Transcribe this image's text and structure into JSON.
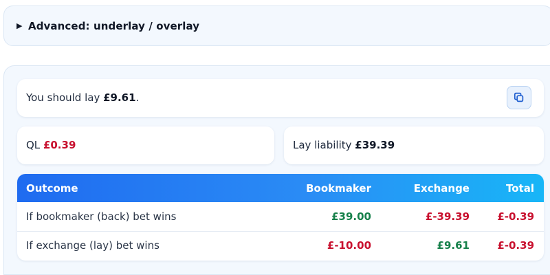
{
  "advanced": {
    "toggle_glyph": "▶",
    "label": "Advanced: underlay / overlay"
  },
  "lay": {
    "prefix": "You should lay ",
    "amount": "£9.61",
    "suffix": ".",
    "copy_icon": "copy-icon"
  },
  "ql": {
    "label": "QL ",
    "value": "£0.39",
    "value_color": "#c8102e"
  },
  "liability": {
    "label": "Lay liability ",
    "value": "£39.39"
  },
  "table": {
    "headers": {
      "outcome": "Outcome",
      "bookmaker": "Bookmaker",
      "exchange": "Exchange",
      "total": "Total"
    },
    "rows": [
      {
        "outcome": "If bookmaker (back) bet wins",
        "bookmaker": "£39.00",
        "exchange": "£-39.39",
        "total": "£-0.39"
      },
      {
        "outcome": "If exchange (lay) bet wins",
        "bookmaker": "£-10.00",
        "exchange": "£9.61",
        "total": "£-0.39"
      }
    ]
  },
  "colors": {
    "negative": "#c8102e",
    "positive": "#16804a",
    "header_gradient_start": "#1f6bf0",
    "header_gradient_end": "#18b6f7",
    "panel_background": "#f3f8fe"
  }
}
